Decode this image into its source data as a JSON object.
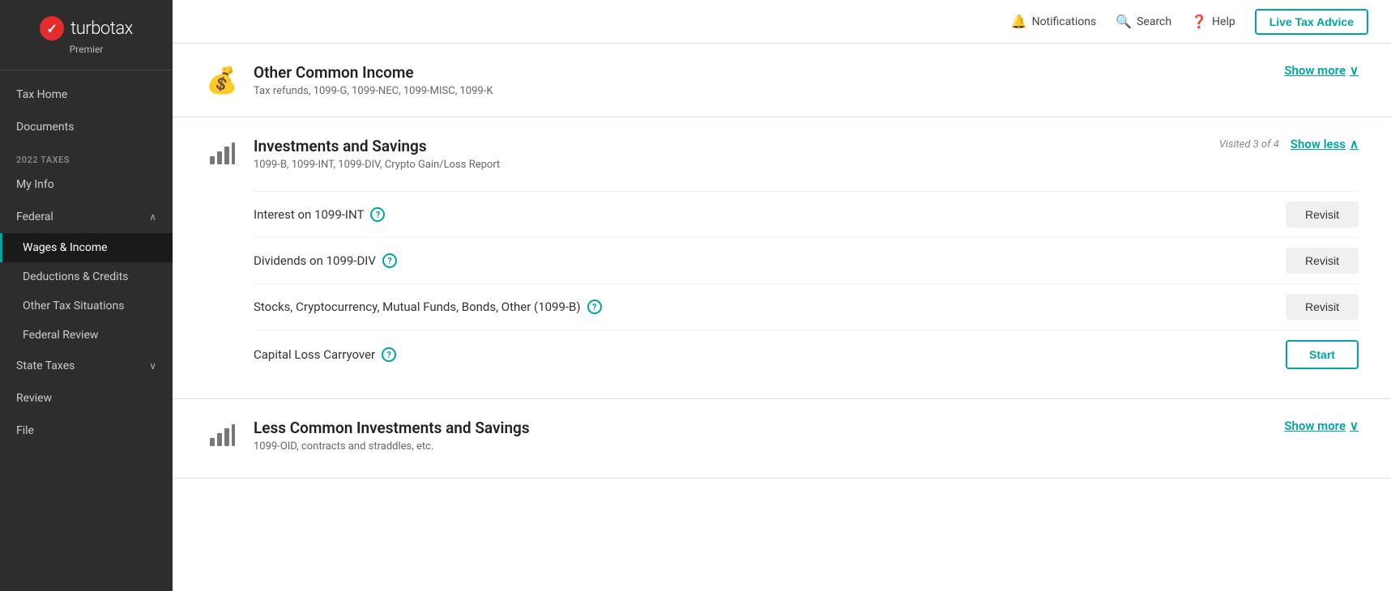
{
  "app": {
    "name": "turbotax",
    "tier": "Premier",
    "logo_check": "✓"
  },
  "sidebar": {
    "section_label": "2022 TAXES",
    "items_top": [
      {
        "id": "tax-home",
        "label": "Tax Home"
      },
      {
        "id": "documents",
        "label": "Documents"
      }
    ],
    "items_federal": [
      {
        "id": "federal",
        "label": "Federal",
        "expandable": true,
        "chevron": "∧"
      },
      {
        "id": "wages-income",
        "label": "Wages & Income",
        "active": true
      },
      {
        "id": "deductions-credits",
        "label": "Deductions & Credits"
      },
      {
        "id": "other-tax",
        "label": "Other Tax Situations"
      },
      {
        "id": "federal-review",
        "label": "Federal Review"
      }
    ],
    "items_state": [
      {
        "id": "state-taxes",
        "label": "State Taxes",
        "expandable": true,
        "chevron": "∨"
      }
    ],
    "items_bottom": [
      {
        "id": "review",
        "label": "Review"
      },
      {
        "id": "file",
        "label": "File"
      }
    ]
  },
  "topnav": {
    "notifications_label": "Notifications",
    "search_label": "Search",
    "help_label": "Help",
    "live_advice_label": "Live Tax Advice"
  },
  "sections": [
    {
      "id": "other-common-income",
      "icon_type": "money",
      "title": "Other Common Income",
      "subtitle": "Tax refunds, 1099-G, 1099-NEC, 1099-MISC, 1099-K",
      "expanded": false,
      "show_toggle": "Show more",
      "show_toggle_arrow": "∨",
      "visited": null
    },
    {
      "id": "investments-savings",
      "icon_type": "bar",
      "title": "Investments and Savings",
      "subtitle": "1099-B, 1099-INT, 1099-DIV, Crypto Gain/Loss Report",
      "expanded": true,
      "show_toggle": "Show less",
      "show_toggle_arrow": "∧",
      "visited": "Visited 3 of 4",
      "rows": [
        {
          "id": "interest-1099int",
          "label": "Interest on 1099-INT",
          "button_type": "revisit",
          "button_label": "Revisit"
        },
        {
          "id": "dividends-1099div",
          "label": "Dividends on 1099-DIV",
          "button_type": "revisit",
          "button_label": "Revisit"
        },
        {
          "id": "stocks-crypto",
          "label": "Stocks, Cryptocurrency, Mutual Funds, Bonds, Other (1099-B)",
          "button_type": "revisit",
          "button_label": "Revisit"
        },
        {
          "id": "capital-loss",
          "label": "Capital Loss Carryover",
          "button_type": "start",
          "button_label": "Start"
        }
      ]
    },
    {
      "id": "less-common-investments",
      "icon_type": "bar",
      "title": "Less Common Investments and Savings",
      "subtitle": "1099-OID, contracts and straddles, etc.",
      "expanded": false,
      "show_toggle": "Show more",
      "show_toggle_arrow": "∨",
      "visited": null
    }
  ]
}
